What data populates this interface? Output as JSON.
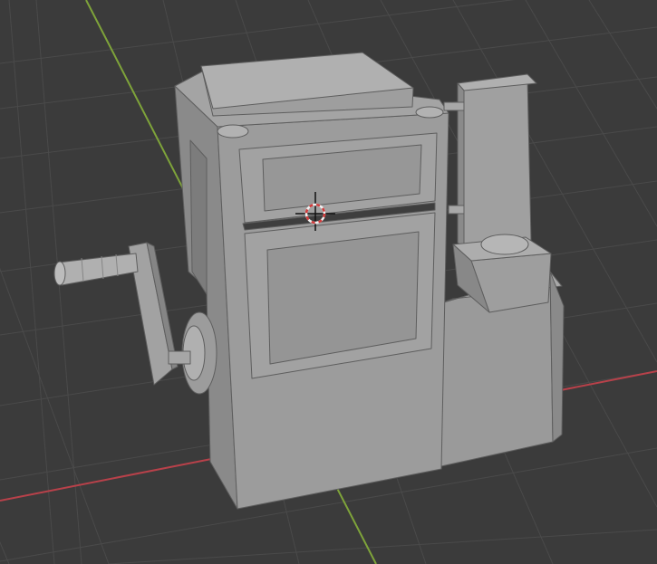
{
  "viewport": {
    "background": "#3b3b3b",
    "grid_color": "#4a4a4a",
    "x_axis_color": "#b8414a",
    "y_axis_color": "#7ea33a"
  },
  "model": {
    "base_color": "#9a9a9a",
    "light_color": "#a8a8a8",
    "mid_color": "#8e8e8e",
    "dark_color": "#707070",
    "edge_color": "#5e5e5e"
  },
  "cursor": {
    "icon": "3d-cursor-icon",
    "ring_color_a": "#d23a3a",
    "ring_color_b": "#f0f0f0"
  }
}
